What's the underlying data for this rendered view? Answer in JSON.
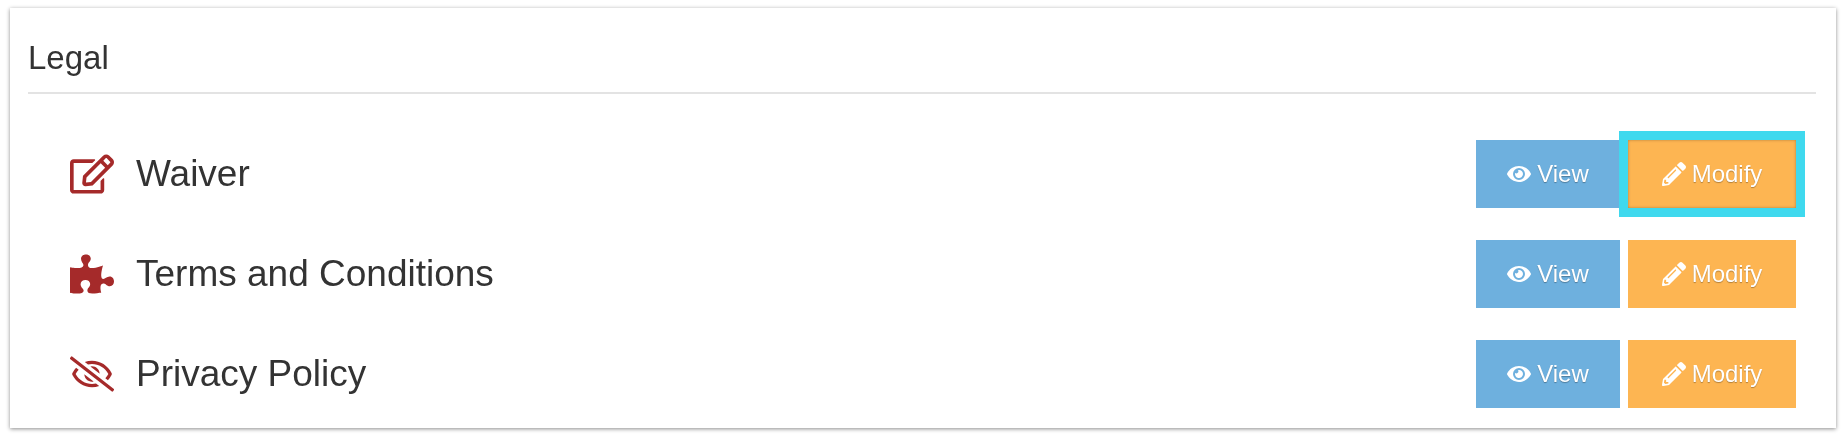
{
  "section": {
    "title": "Legal"
  },
  "documents": [
    {
      "kind": "edit",
      "name": "Waiver",
      "view_label": "View",
      "modify_label": "Modify",
      "modify_focused": true
    },
    {
      "kind": "puzzle",
      "name": "Terms and Conditions",
      "view_label": "View",
      "modify_label": "Modify",
      "modify_focused": false
    },
    {
      "kind": "hidden",
      "name": "Privacy Policy",
      "view_label": "View",
      "modify_label": "Modify",
      "modify_focused": false
    }
  ]
}
